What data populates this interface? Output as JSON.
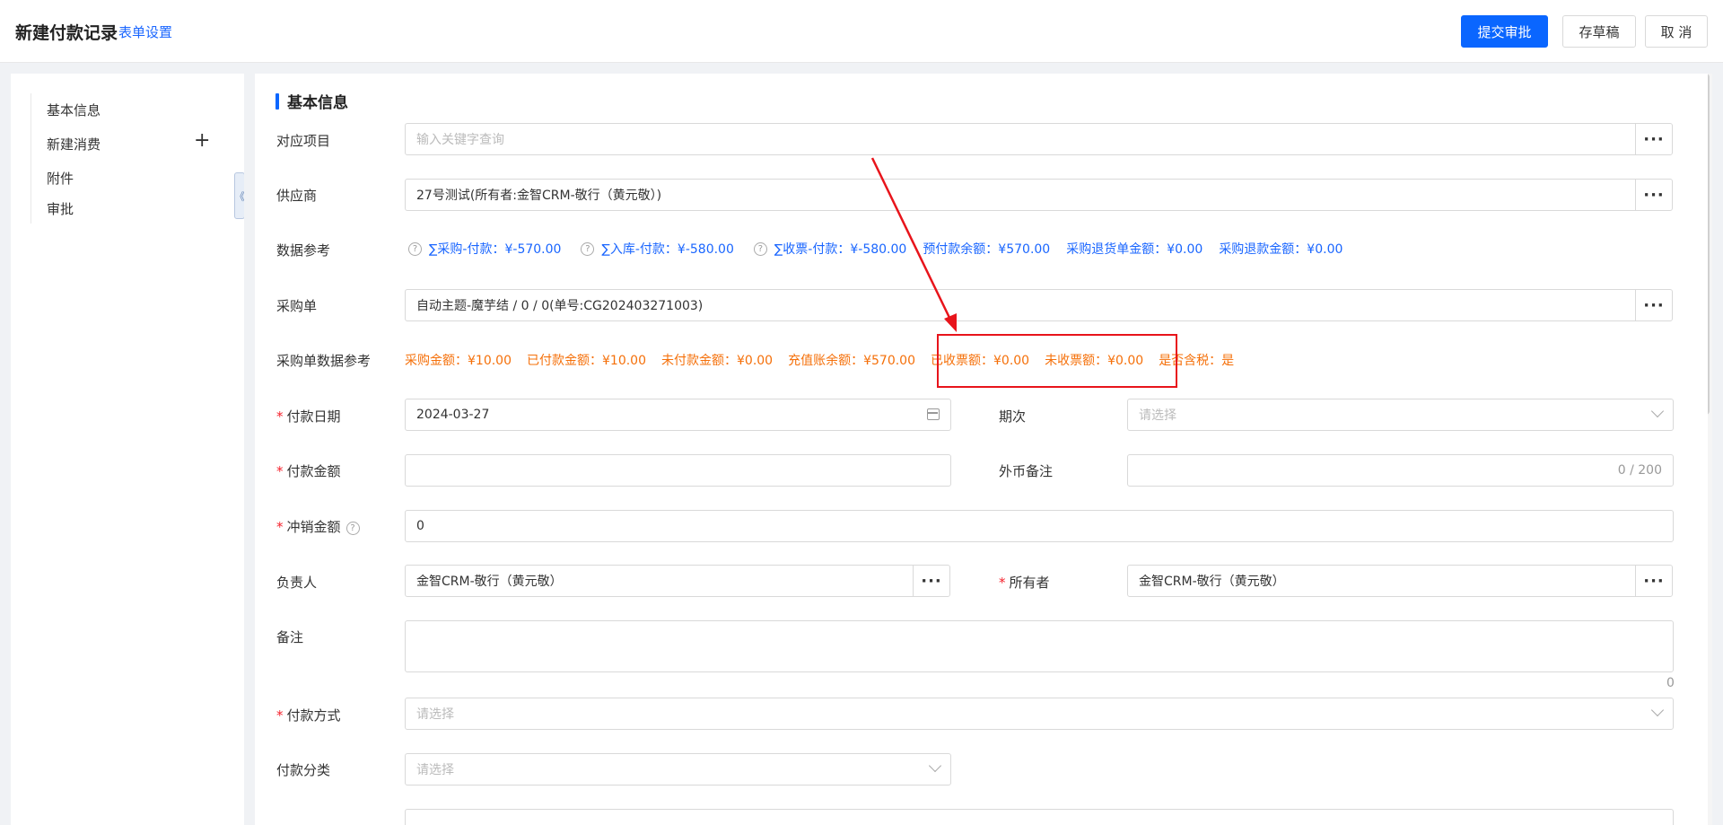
{
  "header": {
    "title": "新建付款记录",
    "form_settings": "表单设置",
    "submit_label": "提交审批",
    "draft_label": "存草稿",
    "cancel_label": "取 消"
  },
  "sidebar": {
    "items": [
      {
        "label": "基本信息"
      },
      {
        "label": "新建消费"
      },
      {
        "label": "附件"
      },
      {
        "label": "审批"
      }
    ],
    "plus": "+",
    "collapse": "《"
  },
  "section": {
    "title": "基本信息"
  },
  "form": {
    "project": {
      "label": "对应项目",
      "placeholder": "输入关键字查询"
    },
    "supplier": {
      "label": "供应商",
      "value": "27号测试(所有者:金智CRM-敬行（黄元敬）)"
    },
    "data_ref": {
      "label": "数据参考",
      "items": [
        "∑采购-付款：¥-570.00",
        "∑入库-付款：¥-580.00",
        "∑收票-付款：¥-580.00",
        "预付款余额：¥570.00",
        "采购退货单金额：¥0.00",
        "采购退款金额：¥0.00"
      ]
    },
    "purchase_order": {
      "label": "采购单",
      "value": "自动主题-魔芋结 / 0 / 0(单号:CG202403271003)"
    },
    "po_ref": {
      "label": "采购单数据参考",
      "items": [
        "采购金额：¥10.00",
        "已付款金额：¥10.00",
        "未付款金额：¥0.00",
        "充值账余额：¥570.00",
        "已收票额：¥0.00",
        "未收票额：¥0.00",
        "是否含税：是"
      ]
    },
    "pay_date": {
      "label": "付款日期",
      "value": "2024-03-27"
    },
    "period": {
      "label": "期次",
      "placeholder": "请选择"
    },
    "pay_amount": {
      "label": "付款金额",
      "value": ""
    },
    "fx_note": {
      "label": "外币备注",
      "counter": "0 / 200"
    },
    "writeoff": {
      "label": "冲销金额",
      "value": "0"
    },
    "owner_person": {
      "label": "负责人",
      "value": "金智CRM-敬行（黄元敬）"
    },
    "owner": {
      "label": "所有者",
      "value": "金智CRM-敬行（黄元敬）"
    },
    "remark": {
      "label": "备注",
      "counter": "0"
    },
    "pay_method": {
      "label": "付款方式",
      "placeholder": "请选择"
    },
    "pay_category": {
      "label": "付款分类",
      "placeholder": "请选择"
    }
  },
  "icons": {
    "dots": "···",
    "question": "?",
    "required": "*"
  },
  "colors": {
    "primary": "#0a66ff",
    "link": "#1a66ff",
    "warning": "#f5700a",
    "annotation": "#e8141b"
  }
}
